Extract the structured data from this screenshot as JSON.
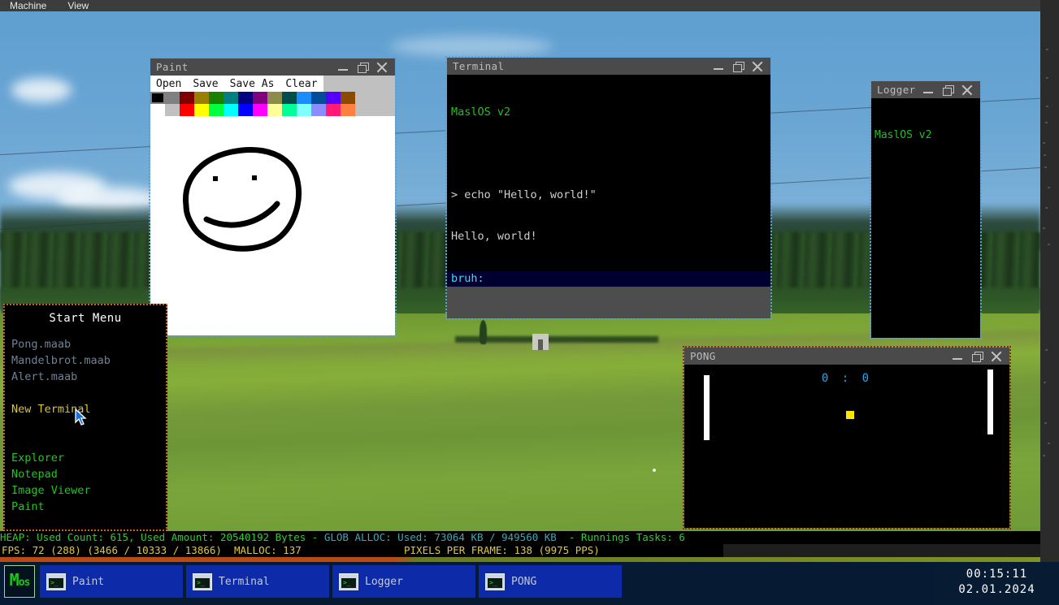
{
  "host": {
    "menus": [
      "Machine",
      "View"
    ]
  },
  "paint": {
    "title": "Paint",
    "menu": [
      "Open",
      "Save",
      "Save As",
      "Clear"
    ],
    "palette_row1": [
      "#000000",
      "#808080",
      "#800000",
      "#998000",
      "#1a8000",
      "#008080",
      "#000080",
      "#800080",
      "#8c8c4d",
      "#004d4d",
      "#1a8cff",
      "#004d99",
      "#5500ff",
      "#8c4a00"
    ],
    "palette_row2": [
      "#ffffff",
      "#c0c0c0",
      "#ff0000",
      "#ffff00",
      "#00ff40",
      "#00ffff",
      "#0000ff",
      "#ff00ff",
      "#ffff99",
      "#00ff99",
      "#80ffff",
      "#8c8cff",
      "#ff1a75",
      "#ff8040"
    ],
    "selected_color": "#000000",
    "drawing": "smiley-face"
  },
  "terminal": {
    "title": "Terminal",
    "banner": "MaslOS v2",
    "lines": [
      "> echo \"Hello, world!\"",
      "Hello, world!"
    ],
    "prompt": "bruh:"
  },
  "logger": {
    "title": "Logger",
    "lines": [
      "MaslOS v2"
    ]
  },
  "pong": {
    "title": "PONG",
    "score_left": "0",
    "score_right": "0",
    "score_text": "0 : 0",
    "ball_color": "#ffe600",
    "paddle_color": "#ffffff"
  },
  "start_menu": {
    "title": "Start Menu",
    "programs": [
      "Pong.maab",
      "Mandelbrot.maab",
      "Alert.maab"
    ],
    "terminal_item": "New Terminal",
    "apps": [
      "Explorer",
      "Notepad",
      "Image Viewer",
      "Paint"
    ]
  },
  "status": {
    "heap_text": "HEAP: Used Count: 615, Used Amount: 20540192 Bytes - ",
    "glob_text": "GLOB ALLOC: Used: 73064 KB / 949560 KB ",
    "tasks_text": " - Runnings Tasks: 6",
    "fps_text": "FPS: 72 (288) (3466 / 10333 / 13866)  MALLOC: 137",
    "pixels_text": "PIXELS PER FRAME: 138 (9975 PPS)"
  },
  "taskbar": {
    "start_label": "Mos",
    "windows": [
      "Paint",
      "Terminal",
      "Logger",
      "PONG"
    ],
    "time": "00:15:11",
    "date": "02.01.2024"
  }
}
